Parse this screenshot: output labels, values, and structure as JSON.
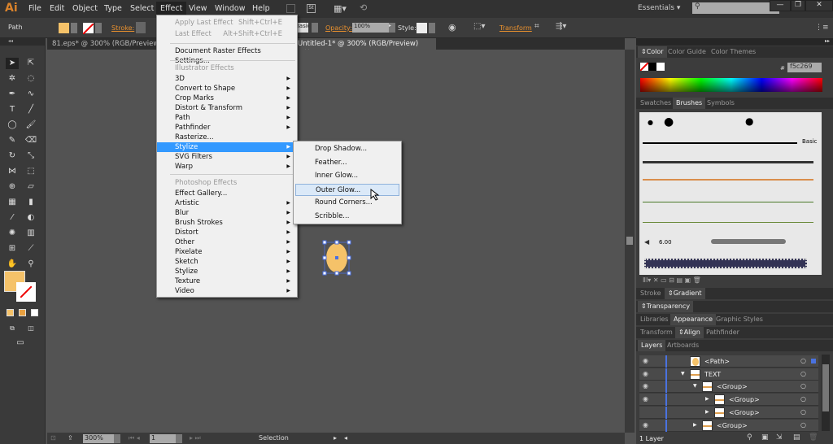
{
  "app": {
    "logo": "Ai",
    "workspace": "Essentials",
    "search_placeholder": ""
  },
  "menu": [
    "File",
    "Edit",
    "Object",
    "Type",
    "Select",
    "Effect",
    "View",
    "Window",
    "Help"
  ],
  "menu_active": "Effect",
  "control": {
    "selection_type": "Path",
    "fill_color": "#f5c269",
    "stroke_label": "Stroke:",
    "brush": "Basic",
    "opacity_label": "Opacity:",
    "opacity": "100%",
    "style_label": "Style:",
    "transform_label": "Transform"
  },
  "documents": [
    {
      "title": "81.eps* @ 300% (RGB/Preview)"
    },
    {
      "title": "Untitled-1* @ 300% (RGB/Preview)",
      "close": "×"
    }
  ],
  "effect_menu": {
    "apply_last": {
      "label": "Apply Last Effect",
      "shortcut": "Shift+Ctrl+E"
    },
    "last": {
      "label": "Last Effect",
      "shortcut": "Alt+Shift+Ctrl+E"
    },
    "raster_settings": "Document Raster Effects Settings...",
    "illustrator_header": "Illustrator Effects",
    "illustrator_items": [
      "3D",
      "Convert to Shape",
      "Crop Marks",
      "Distort & Transform",
      "Path",
      "Pathfinder",
      "Rasterize...",
      "Stylize",
      "SVG Filters",
      "Warp"
    ],
    "photoshop_header": "Photoshop Effects",
    "photoshop_items": [
      "Effect Gallery...",
      "Artistic",
      "Blur",
      "Brush Strokes",
      "Distort",
      "Other",
      "Pixelate",
      "Sketch",
      "Stylize",
      "Texture",
      "Video"
    ]
  },
  "stylize_submenu": [
    "Drop Shadow...",
    "Feather...",
    "Inner Glow...",
    "Outer Glow...",
    "Round Corners...",
    "Scribble..."
  ],
  "stylize_hovered": "Outer Glow...",
  "color_panel": {
    "tabs": [
      "Color",
      "Color Guide",
      "Color Themes"
    ],
    "hex_label": "#",
    "hex": "f5c269"
  },
  "brush_panel": {
    "tabs": [
      "Swatches",
      "Brushes",
      "Symbols"
    ],
    "basic_label": "Basic",
    "size": "6.00"
  },
  "panels": {
    "stroke_gradient": [
      "Stroke",
      "Gradient"
    ],
    "transparency": "Transparency",
    "appearance": [
      "Libraries",
      "Appearance",
      "Graphic Styles"
    ],
    "align": [
      "Transform",
      "Align",
      "Pathfinder"
    ],
    "layers_tabs": [
      "Layers",
      "Artboards"
    ]
  },
  "layers": [
    {
      "name": "<Path>",
      "indent": 0,
      "expand": "",
      "visible": true
    },
    {
      "name": "TEXT",
      "indent": 0,
      "expand": "down",
      "visible": true
    },
    {
      "name": "<Group>",
      "indent": 1,
      "expand": "down",
      "visible": true
    },
    {
      "name": "<Group>",
      "indent": 2,
      "expand": "right",
      "visible": true
    },
    {
      "name": "<Group>",
      "indent": 2,
      "expand": "right",
      "visible": false
    },
    {
      "name": "<Group>",
      "indent": 1,
      "expand": "right",
      "visible": true
    }
  ],
  "layers_count": "1 Layer",
  "status": {
    "zoom": "300%",
    "artboard": "1",
    "tool": "Selection"
  }
}
